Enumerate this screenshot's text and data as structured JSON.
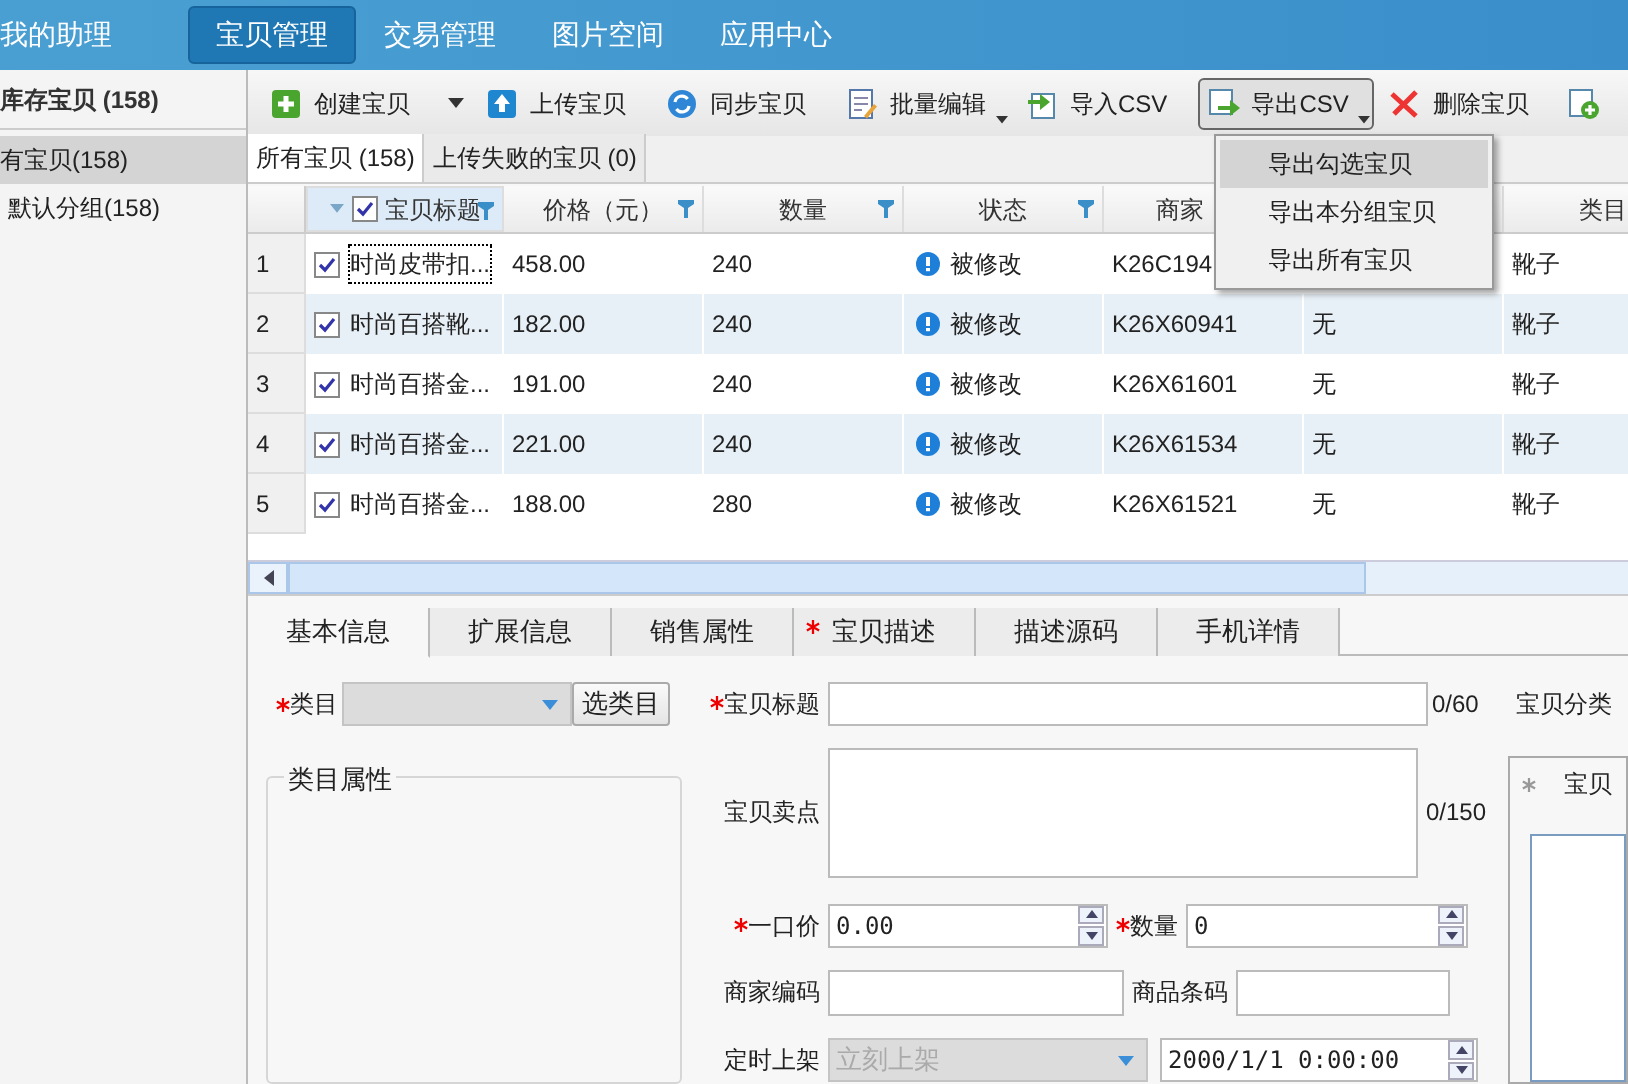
{
  "nav": [
    {
      "label": "我的助理",
      "selected": false
    },
    {
      "label": "宝贝管理",
      "selected": true
    },
    {
      "label": "交易管理",
      "selected": false
    },
    {
      "label": "图片空间",
      "selected": false
    },
    {
      "label": "应用中心",
      "selected": false
    }
  ],
  "sidebar": {
    "title": "库存宝贝 (158)",
    "items": [
      {
        "label": "有宝贝(158)",
        "selected": true,
        "children": [
          {
            "label": "默认分组(158)",
            "selected": false
          }
        ]
      }
    ]
  },
  "toolbar": [
    {
      "kind": "create",
      "label": "创建宝贝"
    },
    {
      "kind": "caret"
    },
    {
      "kind": "upload",
      "label": "上传宝贝"
    },
    {
      "kind": "sync",
      "label": "同步宝贝"
    },
    {
      "kind": "edit",
      "label": "批量编辑",
      "has_menu": true
    },
    {
      "kind": "import",
      "label": "导入CSV"
    },
    {
      "kind": "export",
      "label": "导出CSV",
      "has_menu": true,
      "pressed": true
    },
    {
      "kind": "delete",
      "label": "删除宝贝"
    },
    {
      "kind": "add"
    }
  ],
  "export_menu": [
    {
      "label": "导出勾选宝贝",
      "selected": true
    },
    {
      "label": "导出本分组宝贝",
      "selected": false
    },
    {
      "label": "导出所有宝贝",
      "selected": false
    }
  ],
  "list_tabs": [
    {
      "label": "所有宝贝 (158)",
      "selected": true
    },
    {
      "label": "上传失败的宝贝 (0)",
      "selected": false
    }
  ],
  "table": {
    "all_checked": true,
    "columns": [
      {
        "label": "宝贝标题",
        "filter": true
      },
      {
        "label": "价格（元）",
        "filter": true
      },
      {
        "label": "数量",
        "filter": true
      },
      {
        "label": "状态",
        "filter": true
      },
      {
        "label": "商家"
      },
      {},
      {
        "label": "类目"
      }
    ],
    "rows": [
      {
        "number": "1",
        "checked": true,
        "cells": [
          "时尚皮带扣...",
          "458.00",
          "240",
          "被修改",
          "K26C194",
          "",
          "靴子"
        ]
      },
      {
        "number": "2",
        "checked": true,
        "cells": [
          "时尚百搭靴...",
          "182.00",
          "240",
          "被修改",
          "K26X60941",
          "无",
          "靴子"
        ]
      },
      {
        "number": "3",
        "checked": true,
        "cells": [
          "时尚百搭金...",
          "191.00",
          "240",
          "被修改",
          "K26X61601",
          "无",
          "靴子"
        ]
      },
      {
        "number": "4",
        "checked": true,
        "cells": [
          "时尚百搭金...",
          "221.00",
          "240",
          "被修改",
          "K26X61534",
          "无",
          "靴子"
        ]
      },
      {
        "number": "5",
        "checked": true,
        "cells": [
          "时尚百搭金...",
          "188.00",
          "280",
          "被修改",
          "K26X61521",
          "无",
          "靴子"
        ]
      }
    ]
  },
  "detail_tabs": [
    {
      "label": "基本信息",
      "selected": true,
      "required": false
    },
    {
      "label": "扩展信息",
      "selected": false,
      "required": false
    },
    {
      "label": "销售属性",
      "selected": false,
      "required": false
    },
    {
      "label": "宝贝描述",
      "selected": false,
      "required": true
    },
    {
      "label": "描述源码",
      "selected": false,
      "required": false
    },
    {
      "label": "手机详情",
      "selected": false,
      "required": false
    }
  ],
  "form": {
    "category": {
      "label": "类目",
      "required": true,
      "button": "选类目"
    },
    "category_attributes": {
      "title": "类目属性"
    },
    "title": {
      "label": "宝贝标题",
      "required": true,
      "counter": "0/60"
    },
    "selling_points": {
      "label": "宝贝卖点",
      "required": false,
      "counter": "0/150"
    },
    "price": {
      "label": "一口价",
      "required": true,
      "value": "0.00"
    },
    "quantity": {
      "label": "数量",
      "required": true,
      "value": "0"
    },
    "merchant_code": {
      "label": "商家编码",
      "required": false
    },
    "barcode": {
      "label": "商品条码",
      "required": false
    },
    "schedule": {
      "label": "定时上架",
      "required": false,
      "value": "立刻上架",
      "disabled": true,
      "datetime": "2000/1/1 0:00:00"
    },
    "classification": {
      "label": "宝贝分类",
      "panel_label": "宝贝",
      "required": true
    }
  }
}
